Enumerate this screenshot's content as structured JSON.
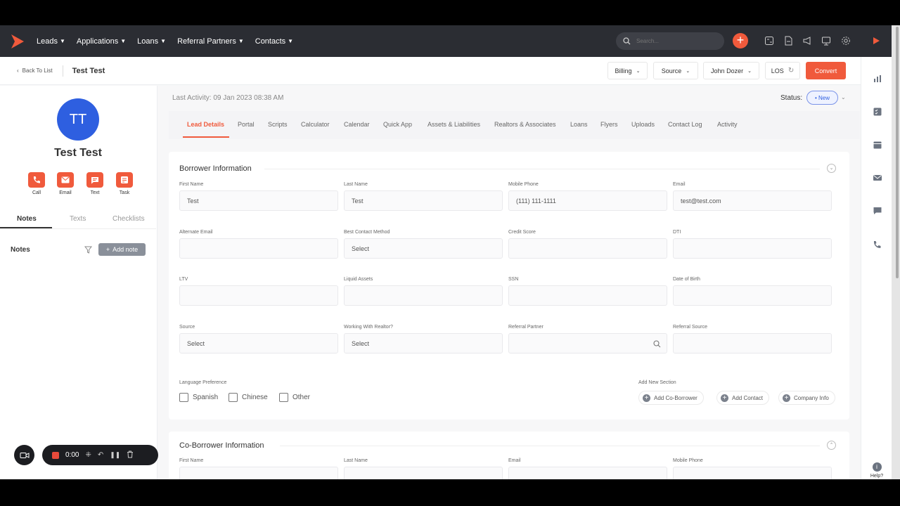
{
  "nav": {
    "items": [
      "Leads",
      "Applications",
      "Loans",
      "Referral Partners",
      "Contacts"
    ],
    "search_placeholder": "Search...",
    "plus_label": "+"
  },
  "subbar": {
    "back_label": "Back To List",
    "title": "Test Test",
    "billing": "Billing",
    "source": "Source",
    "user": "John Dozer",
    "los": "LOS",
    "convert": "Convert"
  },
  "profile": {
    "initials": "TT",
    "name": "Test Test",
    "actions": [
      "Call",
      "Email",
      "Text",
      "Task"
    ],
    "tabs": [
      "Notes",
      "Texts",
      "Checklists"
    ],
    "notes_heading": "Notes",
    "add_note": "Add note"
  },
  "recorder": {
    "time": "0:00"
  },
  "main": {
    "last_activity": "Last Activity: 09 Jan 2023 08:38 AM",
    "status_label": "Status:",
    "status_value": "• New",
    "tabs": [
      "Lead Details",
      "Portal",
      "Scripts",
      "Calculator",
      "Calendar",
      "Quick App",
      "Assets & Liabilities",
      "Realtors & Associates",
      "Loans",
      "Flyers",
      "Uploads",
      "Contact Log",
      "Activity"
    ]
  },
  "borrower": {
    "title": "Borrower Information",
    "labels": [
      "First Name",
      "Last Name",
      "Mobile Phone",
      "Email",
      "Alternate Email",
      "Best Contact Method",
      "Credit Score",
      "DTI",
      "LTV",
      "Liquid Assets",
      "SSN",
      "Date of Birth",
      "Source",
      "Working With Realtor?",
      "Referral Partner",
      "Referral Source"
    ],
    "values": [
      "Test",
      "Test",
      "(111) 111-1111",
      "test@test.com",
      "",
      "Select",
      "",
      "",
      "",
      "",
      "",
      "",
      "Select",
      "Select",
      "",
      ""
    ],
    "language_label": "Language Preference",
    "languages": [
      "Spanish",
      "Chinese",
      "Other"
    ],
    "add_section_label": "Add New Section",
    "add_buttons": [
      "Add Co-Borrower",
      "Add Contact",
      "Company Info"
    ]
  },
  "coborrower": {
    "title": "Co-Borrower Information",
    "labels": [
      "First Name",
      "Last Name",
      "Email",
      "Mobile Phone"
    ]
  },
  "help_label": "Help?",
  "colors": {
    "accent": "#f05a3c",
    "nav_bg": "#2b2d33",
    "avatar": "#2e5fe0"
  }
}
